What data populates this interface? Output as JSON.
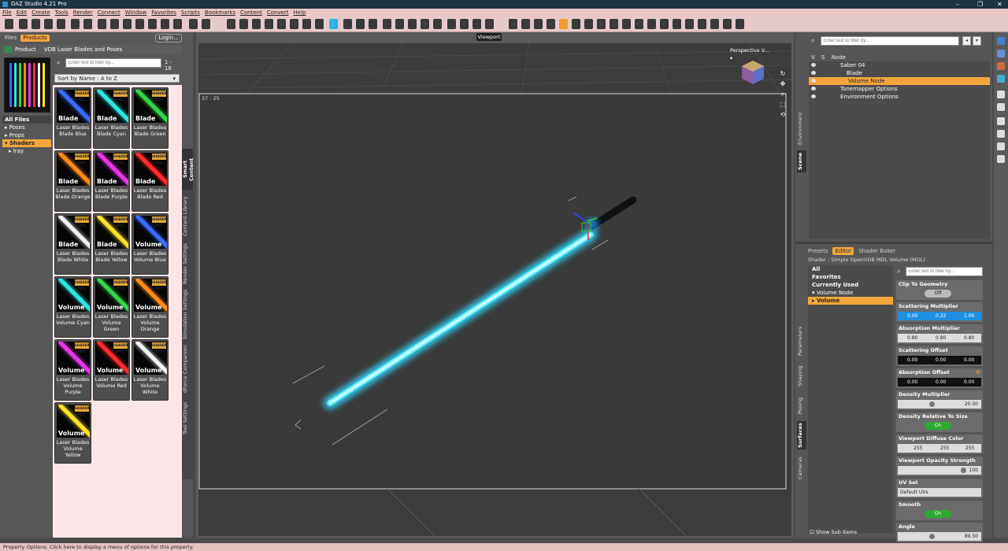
{
  "app": {
    "title": "DAZ Studio 4.21 Pro"
  },
  "window_controls": [
    "–",
    "❐",
    "✕"
  ],
  "menu": [
    "File",
    "Edit",
    "Create",
    "Tools",
    "Render",
    "Connect",
    "Window",
    "Favorites",
    "Scripts",
    "Bookmarks",
    "Content",
    "Convert",
    "Help"
  ],
  "left_panel": {
    "tabs": [
      "Files",
      "Products"
    ],
    "active_tab": "Products",
    "login_label": "Login...",
    "breadcrumb_root": "Product",
    "breadcrumb_product": "VDB Laser Blades and Poses",
    "filter_placeholder": "Enter text to filter by...",
    "count": "1 - 16",
    "sort_label": "Sort by Name : A to Z",
    "tree": [
      {
        "label": "All Files"
      },
      {
        "label": "▸ Poses"
      },
      {
        "label": "▸ Props"
      },
      {
        "label": "▾ Shaders"
      },
      {
        "label": "▸ Iray"
      }
    ],
    "badge_text": "SHADER MDL",
    "products": [
      {
        "word": "Blade",
        "line1": "Laser Blades",
        "line2": "Blade Blue",
        "color": "#3b6cff"
      },
      {
        "word": "Blade",
        "line1": "Laser Blades",
        "line2": "Blade Cyan",
        "color": "#2ee6e6"
      },
      {
        "word": "Blade",
        "line1": "Laser Blades",
        "line2": "Blade Green",
        "color": "#31d64a"
      },
      {
        "word": "Blade",
        "line1": "Laser Blades",
        "line2": "Blade Orange",
        "color": "#ff8a1c"
      },
      {
        "word": "Blade",
        "line1": "Laser Blades",
        "line2": "Blade Purple",
        "color": "#e637e6"
      },
      {
        "word": "Blade",
        "line1": "Laser Blades",
        "line2": "Blade Red",
        "color": "#ff2a2a"
      },
      {
        "word": "Blade",
        "line1": "Laser Blades",
        "line2": "Blade White",
        "color": "#f2f2f2"
      },
      {
        "word": "Blade",
        "line1": "Laser Blades",
        "line2": "Blade Yellow",
        "color": "#ffe22a"
      },
      {
        "word": "Volume",
        "line1": "Laser Blades",
        "line2": "Volume Blue",
        "color": "#3b6cff"
      },
      {
        "word": "Volume",
        "line1": "Laser Blades",
        "line2": "Volume Cyan",
        "color": "#2ee6e6"
      },
      {
        "word": "Volume",
        "line1": "Laser Blades",
        "line2": "Volume Green",
        "color": "#31d64a"
      },
      {
        "word": "Volume",
        "line1": "Laser Blades",
        "line2": "Volume Orange",
        "color": "#ff8a1c"
      },
      {
        "word": "Volume",
        "line1": "Laser Blades",
        "line2": "Volume Purple",
        "color": "#e637e6"
      },
      {
        "word": "Volume",
        "line1": "Laser Blades",
        "line2": "Volume Red",
        "color": "#ff2a2a"
      },
      {
        "word": "Volume",
        "line1": "Laser Blades",
        "line2": "Volume White",
        "color": "#f2f2f2"
      },
      {
        "word": "Volume",
        "line1": "Laser Blades",
        "line2": "Volume Yellow",
        "color": "#ffe22a"
      }
    ],
    "side_tabs": [
      "Smart Content",
      "Content Library",
      "Render Settings",
      "Simulation Settings",
      "dForce Companion",
      "Tool Settings"
    ]
  },
  "viewport": {
    "title": "Viewport",
    "camera_label": "Perspective V...",
    "coord_readout": "37 : 25"
  },
  "scene": {
    "filter_placeholder": "Enter text to filter by...",
    "header_v": "V",
    "header_s": "S",
    "header_node": "Node",
    "nodes": [
      {
        "label": "Saber 04"
      },
      {
        "label": "Blade"
      },
      {
        "label": "Volume Node"
      },
      {
        "label": "Tonemapper Options"
      },
      {
        "label": "Environment Options"
      }
    ],
    "side_tabs": [
      "Environment",
      "Scene"
    ]
  },
  "surfaces": {
    "subtabs": [
      "Presets",
      "Editor",
      "Shader Baker"
    ],
    "active_subtab": "Editor",
    "shader_label": "Shader : Simple OpenVDB MDL Volume (MDL)",
    "filter_placeholder": "Enter text to filter by...",
    "left_list": [
      "All",
      "Favorites",
      "Currently Used",
      "▾ Volume Node",
      "▸ Volume"
    ],
    "properties": {
      "clip": {
        "title": "Clip To Geometry",
        "value": "Off"
      },
      "scatter_mult": {
        "title": "Scattering Multiplier",
        "a": "0.00",
        "b": "0.22",
        "c": "1.00"
      },
      "absorb_mult": {
        "title": "Absorption Multiplier",
        "a": "0.80",
        "b": "0.80",
        "c": "0.80"
      },
      "scatter_off": {
        "title": "Scattering Offset",
        "a": "0.00",
        "b": "0.00",
        "c": "0.00"
      },
      "absorb_off": {
        "title": "Absorption Offset",
        "a": "0.00",
        "b": "0.00",
        "c": "0.00"
      },
      "density": {
        "title": "Density Multiplier",
        "value": "20.00"
      },
      "density_rel": {
        "title": "Density Relative To Size",
        "value": "On"
      },
      "vp_color": {
        "title": "Viewport Diffuse Color",
        "a": "255",
        "b": "255",
        "c": "255"
      },
      "vp_opacity": {
        "title": "Viewport Opacity Strength",
        "value": "100"
      },
      "uv_set": {
        "title": "UV Set",
        "value": "Default UVs"
      },
      "smooth": {
        "title": "Smooth",
        "value": "On"
      },
      "angle": {
        "title": "Angle",
        "value": "89.50"
      }
    },
    "show_sub_items": "Show Sub Items",
    "side_tabs": [
      "Parameters",
      "Shaping",
      "Posing",
      "Surfaces",
      "Cameras"
    ]
  },
  "status": "Property Options: Click here to display a menu of options for this property."
}
